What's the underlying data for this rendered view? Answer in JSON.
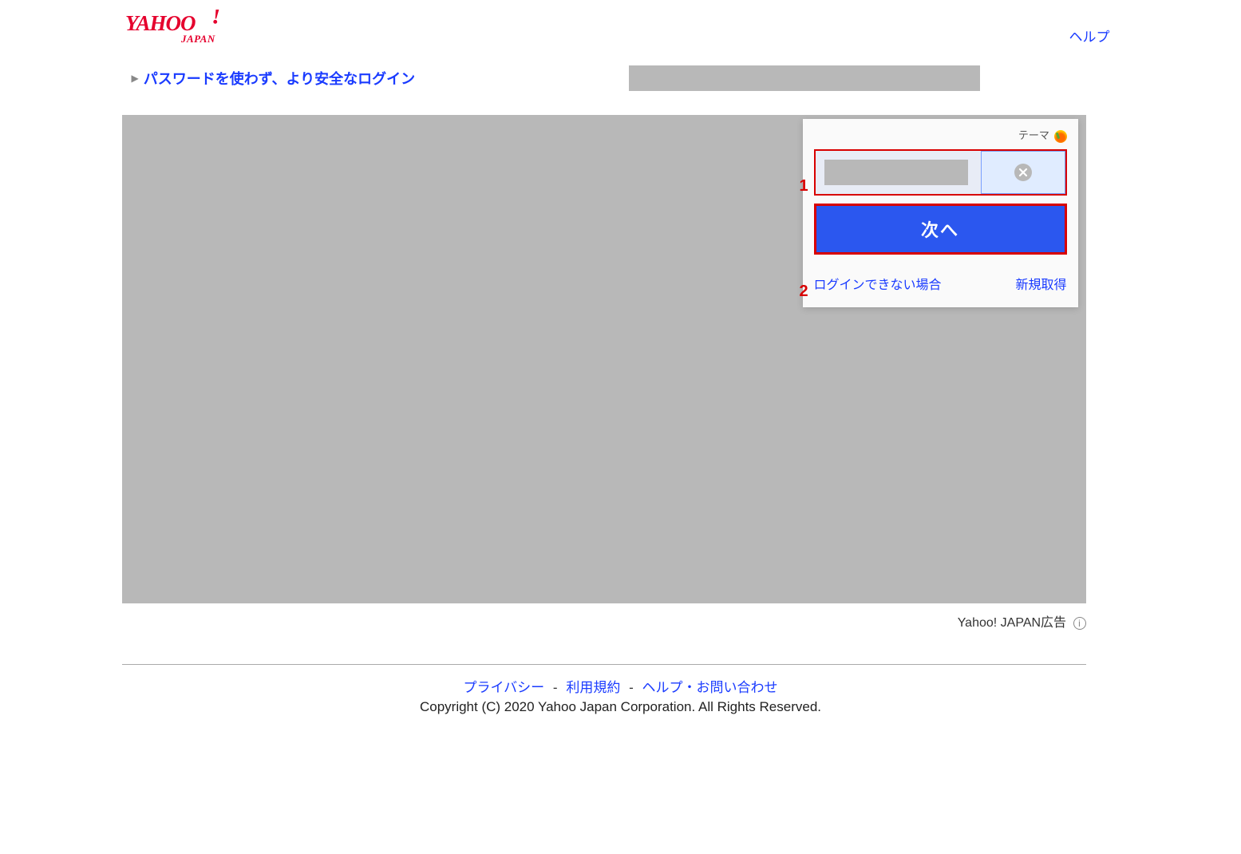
{
  "header": {
    "help_link": "ヘルプ"
  },
  "subheader": {
    "promo_link": "パスワードを使わず、より安全なログイン"
  },
  "login_card": {
    "theme_label": "テーマ",
    "id_value": "",
    "next_button": "次へ",
    "cant_login": "ログインできない場合",
    "register": "新規取得"
  },
  "annotations": {
    "step1": "1",
    "step2": "2"
  },
  "ad_label": "Yahoo! JAPAN広告",
  "footer": {
    "privacy": "プライバシー",
    "terms": "利用規約",
    "help_contact": "ヘルプ・お問い合わせ",
    "separator": "-",
    "copyright": "Copyright (C) 2020 Yahoo Japan Corporation. All Rights Reserved."
  },
  "info_glyph": "i"
}
